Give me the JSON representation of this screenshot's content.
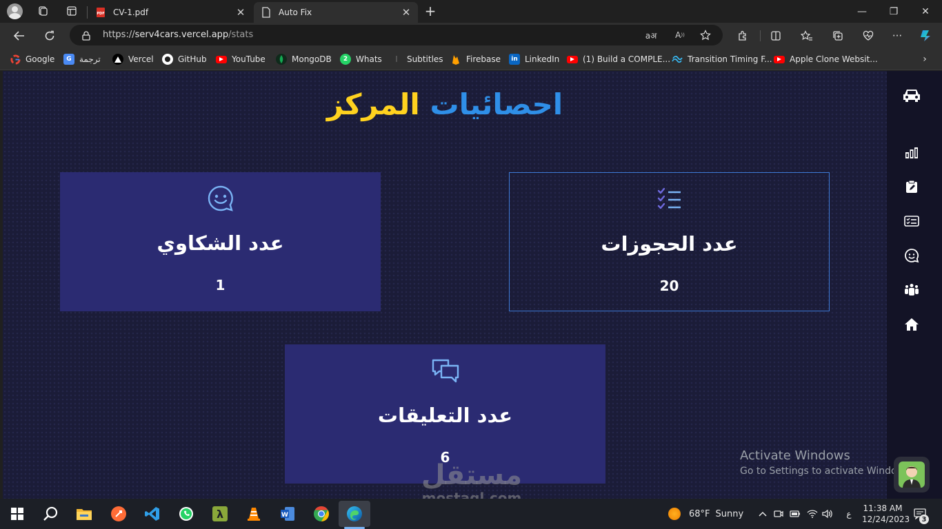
{
  "browser": {
    "tabs": [
      {
        "title": "CV-1.pdf",
        "favicon": "pdf-icon",
        "active": false
      },
      {
        "title": "Auto Fix",
        "favicon": "page-icon",
        "active": true
      }
    ],
    "url": {
      "scheme": "https://",
      "host": "serv4cars.vercel.app",
      "path": "/stats"
    },
    "bookmarks": [
      {
        "label": "Google",
        "icon": "google-icon"
      },
      {
        "label": "ترجمة",
        "icon": "translate-icon"
      },
      {
        "label": "Vercel",
        "icon": "vercel-icon"
      },
      {
        "label": "GitHub",
        "icon": "github-icon"
      },
      {
        "label": "YouTube",
        "icon": "youtube-icon"
      },
      {
        "label": "MongoDB",
        "icon": "mongodb-icon"
      },
      {
        "label": "Whats",
        "icon": "whatsapp-icon"
      },
      {
        "label": "Subtitles",
        "icon": "subtitles-icon"
      },
      {
        "label": "Firebase",
        "icon": "firebase-icon"
      },
      {
        "label": "LinkedIn",
        "icon": "linkedin-icon"
      },
      {
        "label": "(1) Build a COMPLE...",
        "icon": "youtube-icon"
      },
      {
        "label": "Transition Timing F...",
        "icon": "tailwind-icon"
      },
      {
        "label": "Apple Clone Websit...",
        "icon": "youtube-icon"
      }
    ]
  },
  "page": {
    "title_part1": "احصائيات",
    "title_part2": "المركز",
    "cards": {
      "complaints": {
        "label": "عدد الشكاوي",
        "value": "1",
        "icon": "smile-chat-icon"
      },
      "bookings": {
        "label": "عدد الحجوزات",
        "value": "20",
        "icon": "checklist-icon"
      },
      "comments": {
        "label": "عدد التعليقات",
        "value": "6",
        "icon": "comments-icon"
      }
    },
    "sidebar": [
      "car-logo-icon",
      "stats-icon",
      "edit-clipboard-icon",
      "list-icon",
      "chat-icon",
      "teams-icon",
      "home-icon"
    ],
    "colors": {
      "background": "#1b1c38",
      "card": "#2b2b72",
      "title_blue": "#2f8fe8",
      "title_yellow": "#ffd21f",
      "outline": "#3d7ad6"
    }
  },
  "overlay": {
    "activate_line1": "Activate Windows",
    "activate_line2": "Go to Settings to activate Windows.",
    "watermark_ar": "مستقل",
    "watermark_en": "mostaql.com"
  },
  "taskbar": {
    "weather_temp": "68°F",
    "weather_text": "Sunny",
    "time": "11:38 AM",
    "date": "12/24/2023",
    "language": "ع",
    "notifications": "3"
  }
}
